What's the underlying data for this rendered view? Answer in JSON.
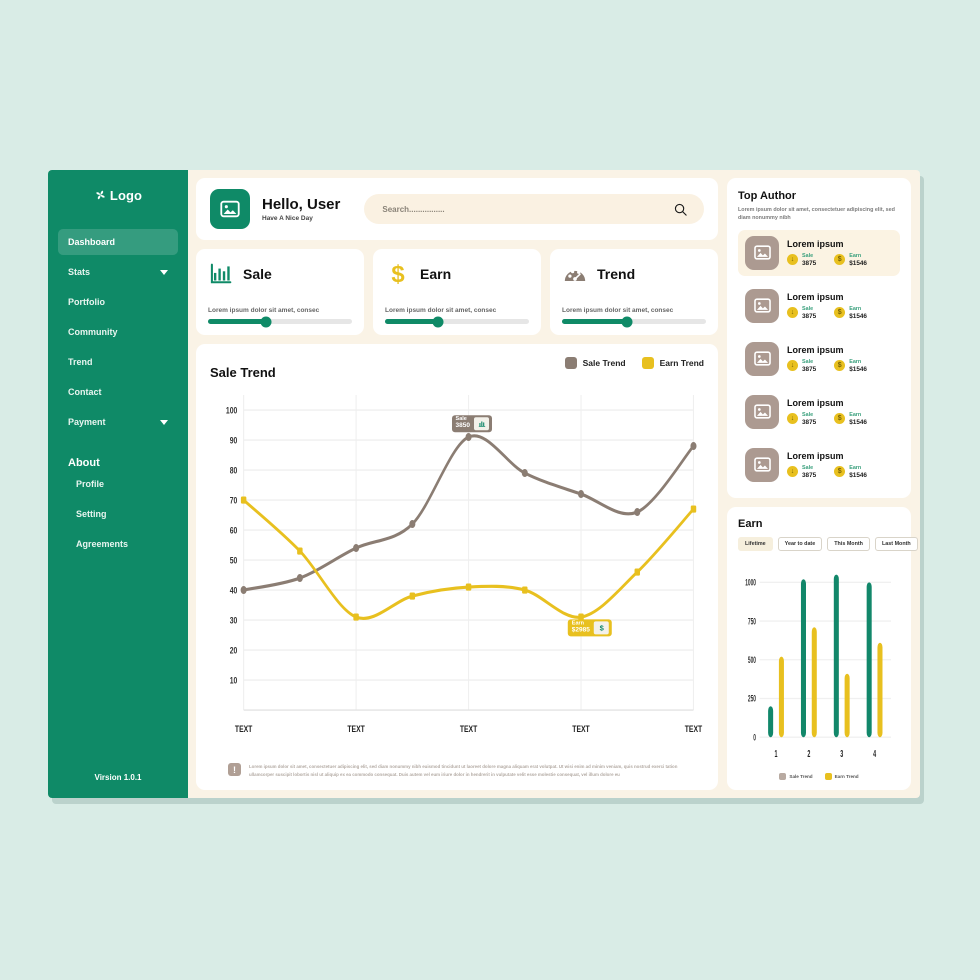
{
  "theme": {
    "page_bg": "#d9ece6",
    "app_bg": "#faf3e6",
    "brand_green": "#0f8a67",
    "sale_color": "#8b7d73",
    "earn_color": "#e8c01f",
    "card_white": "#ffffff"
  },
  "sidebar": {
    "logo": "Logo",
    "logo_icon": "pinwheel-icon",
    "items": [
      {
        "label": "Dashboard",
        "active": true,
        "caret": false
      },
      {
        "label": "Stats",
        "active": false,
        "caret": true
      },
      {
        "label": "Portfolio",
        "active": false,
        "caret": false
      },
      {
        "label": "Community",
        "active": false,
        "caret": false
      },
      {
        "label": "Trend",
        "active": false,
        "caret": false
      },
      {
        "label": "Contact",
        "active": false,
        "caret": false
      },
      {
        "label": "Payment",
        "active": false,
        "caret": true
      }
    ],
    "about_heading": "About",
    "about_items": [
      {
        "label": "Profile"
      },
      {
        "label": "Setting"
      },
      {
        "label": "Agreements"
      }
    ],
    "version": "Virsion 1.0.1"
  },
  "header": {
    "avatar_icon": "image-placeholder-icon",
    "title": "Hello, User",
    "subtitle": "Have A Nice Day",
    "search": {
      "placeholder": "Search................",
      "value": "",
      "icon": "search-icon"
    }
  },
  "stat_cards": [
    {
      "title": "Sale",
      "icon": "bar-chart-icon",
      "icon_color": "#0f8a67",
      "desc": "Lorem ipsum dolor sit amet, consec",
      "progress": 40
    },
    {
      "title": "Earn",
      "icon": "dollar-sign-icon",
      "icon_color": "#e8c01f",
      "desc": "Lorem ipsum dolor sit amet, consec",
      "progress": 37
    },
    {
      "title": "Trend",
      "icon": "speedometer-icon",
      "icon_color": "#8b7d73",
      "desc": "Lorem ipsum dolor sit amet, consec",
      "progress": 45
    }
  ],
  "sale_trend_card": {
    "title": "Sale Trend",
    "legend": [
      {
        "label": "Sale Trend",
        "color": "#8b7d73"
      },
      {
        "label": "Earn Trend",
        "color": "#e8c01f"
      }
    ],
    "tooltips": [
      {
        "name": "Sale",
        "value": "3850",
        "icon": "bar-chart-icon",
        "style": "tt-sale"
      },
      {
        "name": "Earn",
        "value": "$2985",
        "icon": "dollar-bill-icon",
        "style": "tt-earn"
      }
    ],
    "note": {
      "icon": "exclamation-icon",
      "text": "Lorem ipsum dolor sit amet, consectetuer adipiscing elit, sed diam nonummy nibh euismod tincidunt ut laoreet dolore magna aliquam erat volutpat. Ut wisi enim ad minim veniam, quis nostrud exerci tation ullamcorper suscipit lobortis nisl ut aliquip ex ea commodo consequat. Duis autem vel eum iriure dolor in hendrerit in vulputate velit esse molestie consequat, vel illum dolore eu"
    }
  },
  "top_author": {
    "title": "Top Author",
    "subtitle": "Lorem ipsum dolor sit amet, consectetuer adipiscing elit, sed diam nonummy nibh",
    "sale_label": "Sale",
    "earn_label": "Earn",
    "rows": [
      {
        "name": "Lorem ipsum",
        "sale": "3875",
        "earn": "$1546",
        "highlight": true,
        "thumb_icon": "image-placeholder-icon",
        "sale_icon": "arrow-down-coin-icon",
        "earn_icon": "dollar-coin-icon"
      },
      {
        "name": "Lorem ipsum",
        "sale": "3875",
        "earn": "$1546",
        "highlight": false,
        "thumb_icon": "image-placeholder-icon",
        "sale_icon": "arrow-down-coin-icon",
        "earn_icon": "dollar-coin-icon"
      },
      {
        "name": "Lorem ipsum",
        "sale": "3875",
        "earn": "$1546",
        "highlight": false,
        "thumb_icon": "image-placeholder-icon",
        "sale_icon": "arrow-down-coin-icon",
        "earn_icon": "dollar-coin-icon"
      },
      {
        "name": "Lorem ipsum",
        "sale": "3875",
        "earn": "$1546",
        "highlight": false,
        "thumb_icon": "image-placeholder-icon",
        "sale_icon": "arrow-down-coin-icon",
        "earn_icon": "dollar-coin-icon"
      },
      {
        "name": "Lorem ipsum",
        "sale": "3875",
        "earn": "$1546",
        "highlight": false,
        "thumb_icon": "image-placeholder-icon",
        "sale_icon": "arrow-down-coin-icon",
        "earn_icon": "dollar-coin-icon"
      }
    ]
  },
  "earn_card": {
    "title": "Earn",
    "filters": [
      {
        "label": "Lifetime",
        "active": true
      },
      {
        "label": "Year to date",
        "active": false
      },
      {
        "label": "This Month",
        "active": false
      },
      {
        "label": "Last Month",
        "active": false
      }
    ],
    "legend": [
      {
        "label": "Sale Trend",
        "color": "#b8aaa1"
      },
      {
        "label": "Earn Trend",
        "color": "#e8c01f"
      }
    ]
  },
  "chart_data": [
    {
      "type": "line",
      "title": "Sale Trend",
      "xlabel": "",
      "ylabel": "",
      "x": [
        1,
        2,
        3,
        4,
        5,
        6,
        7,
        8,
        9
      ],
      "tick_labels": [
        "TEXT",
        "TEXT",
        "TEXT",
        "TEXT",
        "TEXT"
      ],
      "yticks": [
        10,
        20,
        30,
        40,
        50,
        60,
        70,
        80,
        90,
        100
      ],
      "ylim": [
        0,
        105
      ],
      "grid": true,
      "legend_position": "top-right",
      "series": [
        {
          "name": "Sale Trend",
          "color": "#8b7d73",
          "values": [
            40,
            44,
            54,
            62,
            91,
            79,
            72,
            66,
            88
          ]
        },
        {
          "name": "Earn Trend",
          "color": "#e8c01f",
          "values": [
            70,
            53,
            31,
            38,
            41,
            40,
            31,
            46,
            67
          ]
        }
      ],
      "annotations": [
        {
          "series": "Sale Trend",
          "x": 5,
          "y": 91,
          "label": "Sale",
          "value": "3850"
        },
        {
          "series": "Earn Trend",
          "x": 7,
          "y": 31,
          "label": "Earn",
          "value": "$2985"
        }
      ]
    },
    {
      "type": "bar",
      "title": "Earn",
      "categories": [
        "1",
        "2",
        "3",
        "4"
      ],
      "yticks": [
        0,
        250,
        500,
        750,
        1000
      ],
      "ylim": [
        0,
        1100
      ],
      "grid": true,
      "legend_position": "bottom",
      "series": [
        {
          "name": "Sale Trend",
          "color": "#12876a",
          "values": [
            200,
            1020,
            1050,
            1000
          ]
        },
        {
          "name": "Earn Trend",
          "color": "#e8c01f",
          "values": [
            520,
            710,
            410,
            610
          ]
        }
      ]
    }
  ]
}
